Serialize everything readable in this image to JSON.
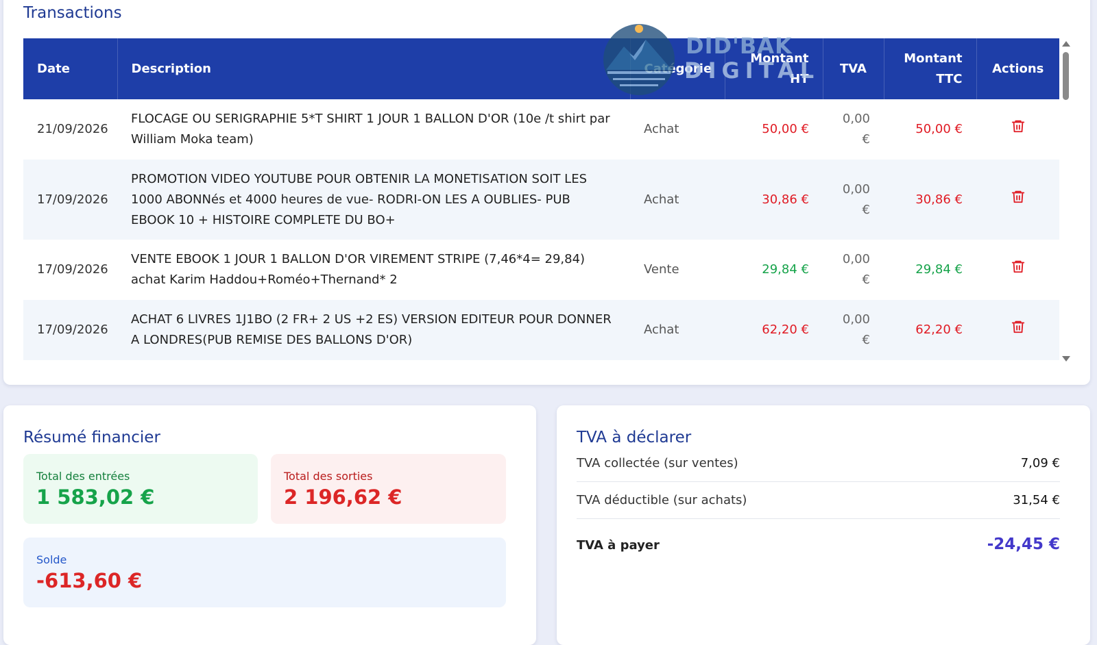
{
  "transactions": {
    "title": "Transactions",
    "headers": {
      "date": "Date",
      "description": "Description",
      "category": "Catégorie",
      "amount_ht_1": "Montant",
      "amount_ht_2": "HT",
      "vat": "TVA",
      "amount_ttc_1": "Montant",
      "amount_ttc_2": "TTC",
      "actions": "Actions"
    },
    "rows": [
      {
        "date": "21/09/2026",
        "description": "FLOCAGE OU SERIGRAPHIE 5*T SHIRT 1 JOUR 1 BALLON D'OR (10e /t shirt par William Moka team)",
        "category": "Achat",
        "ht": "50,00 €",
        "vat": "0,00 €",
        "ttc": "50,00 €",
        "kind": "neg"
      },
      {
        "date": "17/09/2026",
        "description": "PROMOTION VIDEO YOUTUBE POUR OBTENIR LA MONETISATION SOIT LES 1000 ABONNés et 4000 heures de vue- RODRI-ON LES A OUBLIES- PUB EBOOK 10 + HISTOIRE COMPLETE DU BO+",
        "category": "Achat",
        "ht": "30,86 €",
        "vat": "0,00 €",
        "ttc": "30,86 €",
        "kind": "neg"
      },
      {
        "date": "17/09/2026",
        "description": "VENTE EBOOK 1 JOUR 1 BALLON D'OR VIREMENT STRIPE (7,46*4= 29,84) achat Karim Haddou+Roméo+Thernand* 2",
        "category": "Vente",
        "ht": "29,84 €",
        "vat": "0,00 €",
        "ttc": "29,84 €",
        "kind": "pos"
      },
      {
        "date": "17/09/2026",
        "description": "ACHAT 6 LIVRES 1J1BO (2 FR+ 2 US +2 ES) VERSION EDITEUR POUR DONNER A LONDRES(PUB REMISE DES BALLONS D'OR)",
        "category": "Achat",
        "ht": "62,20 €",
        "vat": "0,00 €",
        "ttc": "62,20 €",
        "kind": "neg"
      }
    ]
  },
  "watermark": {
    "line1": "DID'BAK",
    "line2": "DIGITAL"
  },
  "summary": {
    "title": "Résumé financier",
    "income_label": "Total des entrées",
    "income_value": "1 583,02 €",
    "expense_label": "Total des sorties",
    "expense_value": "2 196,62 €",
    "balance_label": "Solde",
    "balance_value": "-613,60 €"
  },
  "vat": {
    "title": "TVA à déclarer",
    "collected_label": "TVA collectée (sur ventes)",
    "collected_value": "7,09 €",
    "deductible_label": "TVA déductible (sur achats)",
    "deductible_value": "31,54 €",
    "payable_label": "TVA à payer",
    "payable_value": "-24,45 €"
  },
  "colors": {
    "header": "#1e3ea8",
    "negative": "#e01b24",
    "positive": "#16a34a",
    "accent": "#4338ca"
  },
  "icons": {
    "delete": "trash-icon"
  }
}
